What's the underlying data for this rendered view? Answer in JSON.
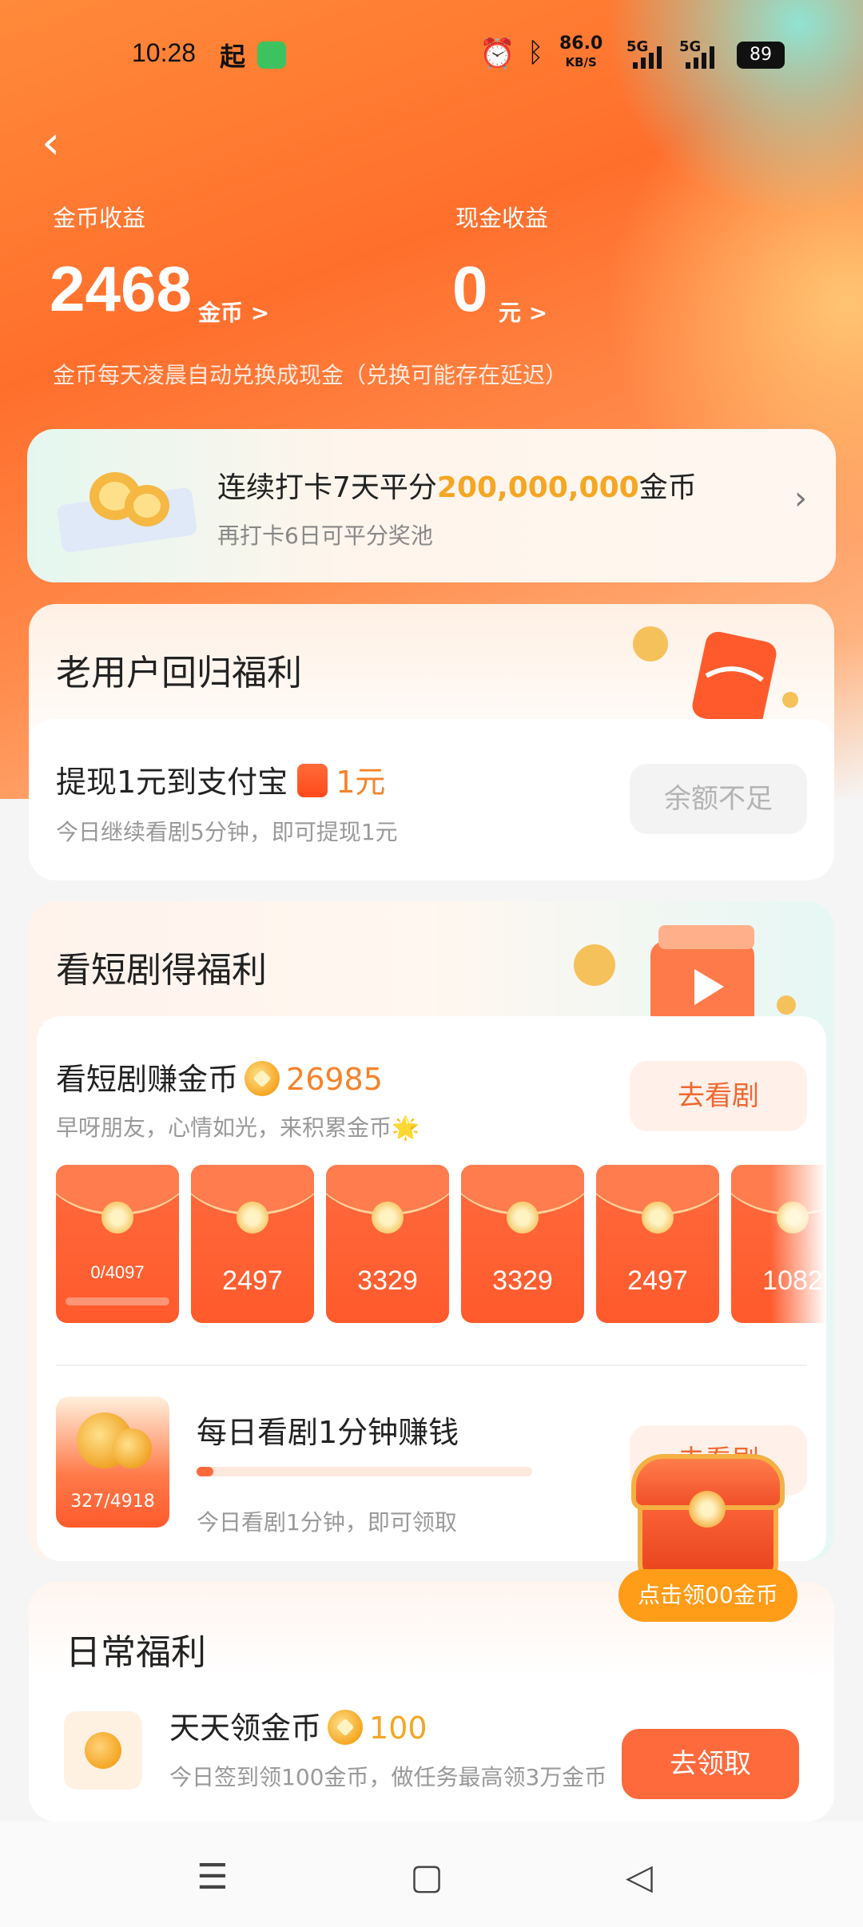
{
  "status_bar": {
    "time": "10:28",
    "app_glyph": "起",
    "net_speed_value": "86.0",
    "net_speed_unit": "KB/S",
    "sim1": "5G",
    "sim2": "5G",
    "battery": "89"
  },
  "earnings": {
    "coin_label": "金币收益",
    "coin_value": "2468",
    "coin_unit": "金币 >",
    "cash_label": "现金收益",
    "cash_value": "0",
    "cash_unit": "元 >",
    "note": "金币每天凌晨自动兑换成现金（兑换可能存在延迟）"
  },
  "checkin": {
    "title_prefix": "连续打卡7天平分",
    "title_amount": "200,000,000",
    "title_suffix": "金币",
    "subtitle": "再打卡6日可平分奖池"
  },
  "return_bonus": {
    "heading": "老用户回归福利",
    "task_title": "提现1元到支付宝",
    "task_reward": "1元",
    "task_desc": "今日继续看剧5分钟，即可提现1元",
    "button": "余额不足"
  },
  "drama": {
    "heading": "看短剧得福利",
    "task_title": "看短剧赚金币",
    "task_coins": "26985",
    "task_desc": "早呀朋友，心情如光，来积累金币🌟",
    "button": "去看剧",
    "envelopes": [
      {
        "value": "0/4097",
        "progress": 0.0
      },
      {
        "value": "2497"
      },
      {
        "value": "3329"
      },
      {
        "value": "3329"
      },
      {
        "value": "2497"
      },
      {
        "value": "1082"
      }
    ],
    "daily_icon_count": "327/4918",
    "daily_title": "每日看剧1分钟赚钱",
    "daily_progress": 0.05,
    "daily_desc": "今日看剧1分钟，即可领取",
    "daily_button": "去看剧"
  },
  "float_reward": {
    "label": "点击领00金币"
  },
  "daily_welfare": {
    "heading": "日常福利",
    "task_title": "天天领金币",
    "task_coins": "100",
    "task_desc": "今日签到领100金币，做任务最高领3万金币",
    "button": "去领取"
  },
  "colors": {
    "accent": "#ff6a3d",
    "coin_gold": "#f5a623",
    "cta_orange": "#f2662f"
  }
}
